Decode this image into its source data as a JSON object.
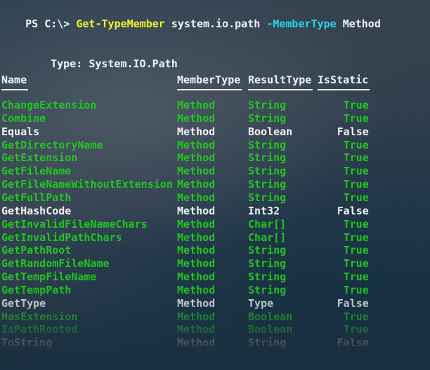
{
  "terminal": {
    "prompt": {
      "prefix": "PS C:\\>",
      "command": "Get-TypeMember",
      "argument": "system.io.path",
      "parameter": "-MemberType",
      "parameter_value": "Method"
    },
    "type_line": {
      "label": "Type:",
      "value": "System.IO.Path"
    },
    "colors": {
      "background": "#2c3c4c",
      "background_bottom": "#1b3040",
      "foreground": "#f2f4f6",
      "static_green": "#22c422",
      "command_yellow": "#f5f52a",
      "parameter_cyan": "#2ad4e6"
    },
    "table": {
      "columns": [
        {
          "key": "name",
          "header": "Name",
          "align": "left"
        },
        {
          "key": "member_type",
          "header": "MemberType",
          "align": "left"
        },
        {
          "key": "result_type",
          "header": "ResultType",
          "align": "left"
        },
        {
          "key": "is_static",
          "header": "IsStatic",
          "align": "right"
        }
      ],
      "rows": [
        {
          "name": "ChangeExtension",
          "member_type": "Method",
          "result_type": "String",
          "is_static": "True",
          "static": true
        },
        {
          "name": "Combine",
          "member_type": "Method",
          "result_type": "String",
          "is_static": "True",
          "static": true
        },
        {
          "name": "Equals",
          "member_type": "Method",
          "result_type": "Boolean",
          "is_static": "False",
          "static": false
        },
        {
          "name": "GetDirectoryName",
          "member_type": "Method",
          "result_type": "String",
          "is_static": "True",
          "static": true
        },
        {
          "name": "GetExtension",
          "member_type": "Method",
          "result_type": "String",
          "is_static": "True",
          "static": true
        },
        {
          "name": "GetFileName",
          "member_type": "Method",
          "result_type": "String",
          "is_static": "True",
          "static": true
        },
        {
          "name": "GetFileNameWithoutExtension",
          "member_type": "Method",
          "result_type": "String",
          "is_static": "True",
          "static": true
        },
        {
          "name": "GetFullPath",
          "member_type": "Method",
          "result_type": "String",
          "is_static": "True",
          "static": true
        },
        {
          "name": "GetHashCode",
          "member_type": "Method",
          "result_type": "Int32",
          "is_static": "False",
          "static": false
        },
        {
          "name": "GetInvalidFileNameChars",
          "member_type": "Method",
          "result_type": "Char[]",
          "is_static": "True",
          "static": true
        },
        {
          "name": "GetInvalidPathChars",
          "member_type": "Method",
          "result_type": "Char[]",
          "is_static": "True",
          "static": true
        },
        {
          "name": "GetPathRoot",
          "member_type": "Method",
          "result_type": "String",
          "is_static": "True",
          "static": true
        },
        {
          "name": "GetRandomFileName",
          "member_type": "Method",
          "result_type": "String",
          "is_static": "True",
          "static": true
        },
        {
          "name": "GetTempFileName",
          "member_type": "Method",
          "result_type": "String",
          "is_static": "True",
          "static": true
        },
        {
          "name": "GetTempPath",
          "member_type": "Method",
          "result_type": "String",
          "is_static": "True",
          "static": true
        },
        {
          "name": "GetType",
          "member_type": "Method",
          "result_type": "Type",
          "is_static": "False",
          "static": false
        },
        {
          "name": "HasExtension",
          "member_type": "Method",
          "result_type": "Boolean",
          "is_static": "True",
          "static": true
        },
        {
          "name": "IsPathRooted",
          "member_type": "Method",
          "result_type": "Boolean",
          "is_static": "True",
          "static": true
        },
        {
          "name": "ToString",
          "member_type": "Method",
          "result_type": "String",
          "is_static": "False",
          "static": false
        }
      ]
    }
  }
}
